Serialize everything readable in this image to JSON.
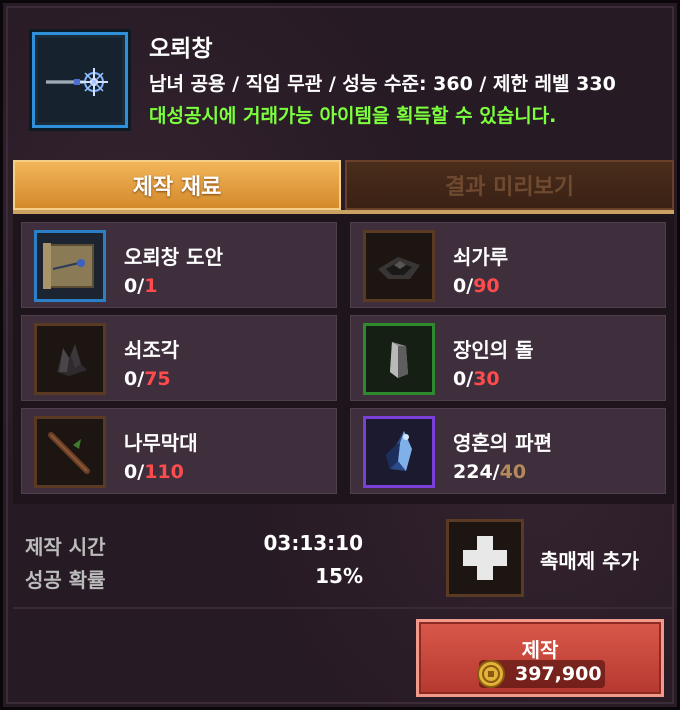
{
  "item": {
    "name": "오뢰창",
    "info": "남녀 공용 / 직업 무관 / 성능 수준: 360 / 제한 레벨 330",
    "trade_note": "대성공시에 거래가능 아이템을 획득할 수 있습니다.",
    "icon": "spear-icon"
  },
  "tabs": [
    {
      "label": "제작 재료",
      "active": true
    },
    {
      "label": "결과 미리보기",
      "active": false
    }
  ],
  "materials": [
    {
      "name": "오뢰창 도안",
      "have": "0",
      "need": "1",
      "icon": "blueprint-scroll-icon",
      "frame": "blue"
    },
    {
      "name": "쇠가루",
      "have": "0",
      "need": "90",
      "icon": "iron-powder-icon",
      "frame": "brown"
    },
    {
      "name": "쇠조각",
      "have": "0",
      "need": "75",
      "icon": "iron-fragment-icon",
      "frame": "brown"
    },
    {
      "name": "장인의 돌",
      "have": "0",
      "need": "30",
      "icon": "artisan-stone-icon",
      "frame": "green"
    },
    {
      "name": "나무막대",
      "have": "0",
      "need": "110",
      "icon": "wooden-stick-icon",
      "frame": "brown"
    },
    {
      "name": "영혼의 파편",
      "have": "224",
      "need": "40",
      "icon": "soul-shard-icon",
      "frame": "purple"
    }
  ],
  "stats": {
    "time_label": "제작 시간",
    "time_value": "03:13:10",
    "rate_label": "성공 확률",
    "rate_value": "15%"
  },
  "catalyst": {
    "label": "촉매제 추가",
    "icon": "plus-icon"
  },
  "craft": {
    "label": "제작",
    "cost": "397,900",
    "icon": "gold-coin-icon"
  },
  "colors": {
    "accent_green": "#7cff3c",
    "shortage_red": "#ff4b4b",
    "tab_active": "#e9a245",
    "craft_button": "#c9463b"
  }
}
